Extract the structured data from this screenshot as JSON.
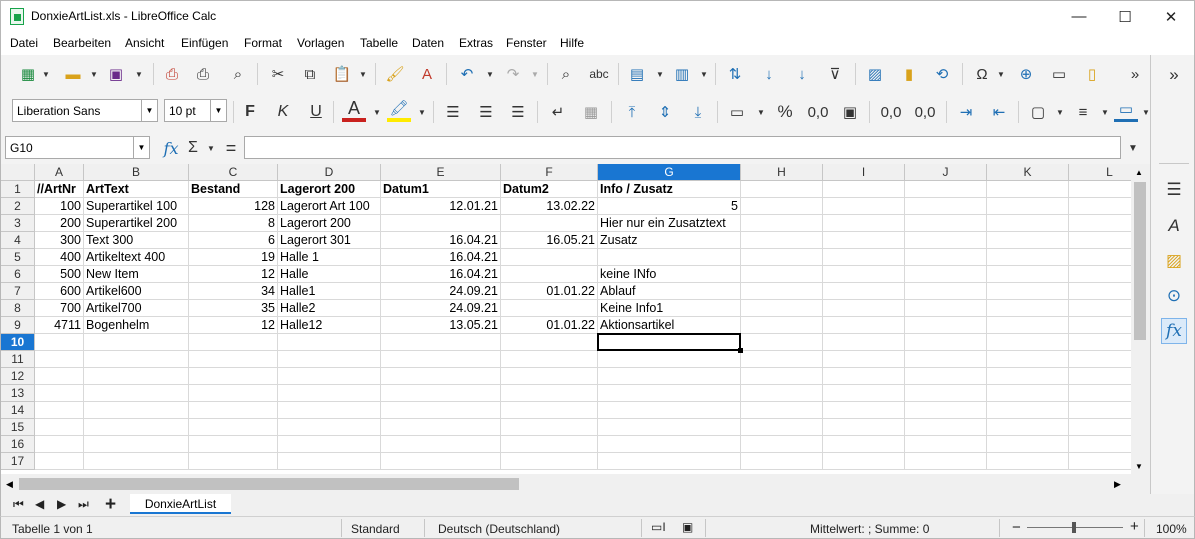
{
  "window": {
    "title": "DonxieArtList.xls - LibreOffice Calc",
    "minimize": "—",
    "maximize": "☐",
    "close": "✕"
  },
  "menu": [
    "Datei",
    "Bearbeiten",
    "Ansicht",
    "Einfügen",
    "Format",
    "Vorlagen",
    "Tabelle",
    "Daten",
    "Extras",
    "Fenster",
    "Hilfe"
  ],
  "format_toolbar": {
    "font_name": "Liberation Sans",
    "font_size": "10 pt",
    "bold": "F",
    "italic": "K",
    "underline": "U",
    "percent": "%",
    "number": "0,0",
    "add_decimal": "0,0",
    "del_decimal": "0,0"
  },
  "formula_bar": {
    "name_box": "G10",
    "fx": "fx",
    "sum": "Σ",
    "equals": "=",
    "value": ""
  },
  "sheet": {
    "columns": [
      "A",
      "B",
      "C",
      "D",
      "E",
      "F",
      "G",
      "H",
      "I",
      "J",
      "K",
      "L"
    ],
    "selected_column": "G",
    "rows": [
      "1",
      "2",
      "3",
      "4",
      "5",
      "6",
      "7",
      "8",
      "9",
      "10",
      "11",
      "12",
      "13",
      "14",
      "15",
      "16",
      "17"
    ],
    "selected_row": "10",
    "cells": [
      [
        "//ArtNr",
        "ArtText",
        "Bestand",
        "Lagerort 200",
        "Datum1",
        "Datum2",
        "Info / Zusatz"
      ],
      [
        "100",
        "Superartikel 100",
        "128",
        "Lagerort Art 100",
        "12.01.21",
        "13.02.22",
        "5"
      ],
      [
        "200",
        "Superartikel 200",
        "8",
        "Lagerort 200",
        "",
        "",
        "Hier nur ein Zusatztext"
      ],
      [
        "300",
        "Text 300",
        "6",
        "Lagerort 301",
        "16.04.21",
        "16.05.21",
        "Zusatz"
      ],
      [
        "400",
        "Artikeltext 400",
        "19",
        "Halle 1",
        "16.04.21",
        "",
        ""
      ],
      [
        "500",
        "New Item",
        "12",
        "Halle",
        "16.04.21",
        "",
        "keine INfo"
      ],
      [
        "600",
        "Artikel600",
        "34",
        "Halle1",
        "24.09.21",
        "01.01.22",
        "Ablauf"
      ],
      [
        "700",
        "Artikel700",
        "35",
        "Halle2",
        "24.09.21",
        "",
        "Keine Info1"
      ],
      [
        "4711",
        "Bogenhelm",
        "12",
        "Halle12",
        "13.05.21",
        "01.01.22",
        "Aktionsartikel"
      ]
    ]
  },
  "tabs": {
    "add": "+",
    "sheet_name": "DonxieArtList"
  },
  "status": {
    "sheet_of": "Tabelle 1 von 1",
    "page_style": "Standard",
    "language": "Deutsch (Deutschland)",
    "summary": "Mittelwert: ; Summe: 0",
    "zoom_minus": "−",
    "zoom_plus": "+",
    "zoom": "100%"
  }
}
